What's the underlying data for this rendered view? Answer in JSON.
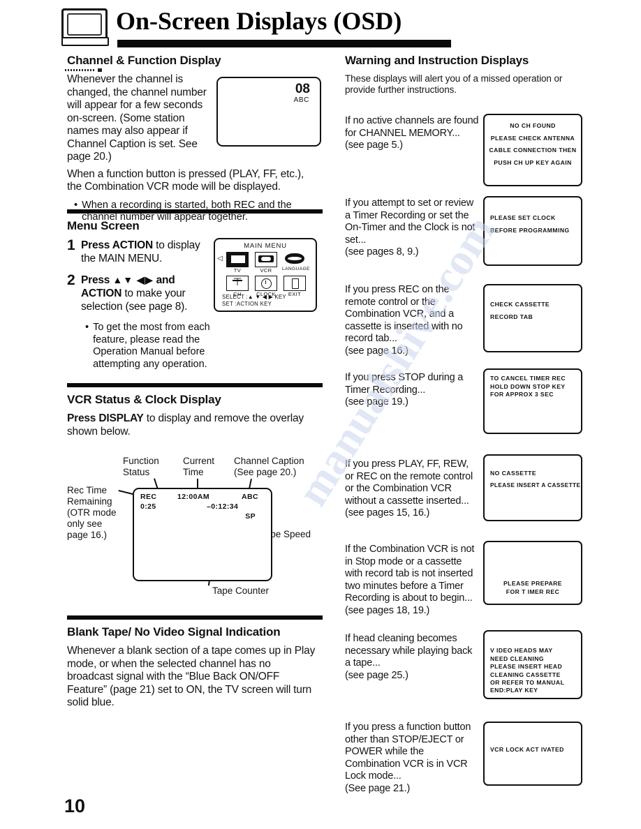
{
  "header": {
    "title": "On-Screen Displays (OSD)",
    "logo_icon": "tv-monitor-icon"
  },
  "page_number": "10",
  "left_column": {
    "section1": {
      "heading": "Channel & Function Display",
      "paragraph1": "Whenever the channel is changed, the channel number will appear for a few seconds on-screen. (Some station names may also appear if Channel Caption is set. See page 20.)",
      "paragraph2": "When a function button is pressed (PLAY, FF, etc.), the Combination VCR mode will be displayed.",
      "bullet": "When a recording is started, both REC and the channel number will appear together.",
      "tv_screen": {
        "channel_number": "08",
        "channel_caption": "ABC"
      }
    },
    "section2": {
      "heading": "Menu Screen",
      "step1_num": "1",
      "step1_a": "Press ACTION",
      "step1_b": " to display the MAIN MENU.",
      "step2_num": "2",
      "step2_a": "Press ",
      "step2_arrows": "▲▼ ◀▶",
      "step2_b": " and ",
      "step2_c": "ACTION",
      "step2_d": " to make your selection (see page 8).",
      "bullet": "To get the most from each feature, please read the Operation Manual before attempting any operation.",
      "main_menu": {
        "title": "MAIN MENU",
        "items": [
          {
            "label": "TV",
            "icon": "tv-icon"
          },
          {
            "label": "VCR",
            "icon": "cassette-icon"
          },
          {
            "label": "LANGUAGE",
            "icon": "mouth-icon"
          },
          {
            "label": "CH",
            "icon": "antenna-icon"
          },
          {
            "label": "CLOCK",
            "icon": "clock-icon"
          },
          {
            "label": "EXIT",
            "icon": "door-icon"
          }
        ],
        "footer_line1": "SELECT :▲ ▼ ◀ ▶  KEY",
        "footer_line2": "SET      :ACTION KEY",
        "cursor": "◁"
      }
    },
    "section3": {
      "heading": "VCR Status & Clock Display",
      "intro_bold": "Press DISPLAY",
      "intro_rest": " to display and remove the overlay shown below.",
      "callouts": {
        "function_status": "Function\nStatus",
        "current_time": "Current\nTime",
        "channel_caption": "Channel Caption\n(See page 20.)",
        "rec_time_remaining": "Rec Time\nRemaining\n(OTR mode\nonly see\npage 16.)",
        "tape_speed": "Tape Speed",
        "tape_counter": "Tape Counter"
      },
      "overlay": {
        "status": "REC",
        "rec_remaining": "0:25",
        "clock": "12:00AM",
        "caption": "ABC",
        "counter": "–0:12:34",
        "speed": "SP"
      }
    },
    "section4": {
      "heading": "Blank Tape/ No Video Signal Indication",
      "paragraph": "Whenever a blank section of a tape comes up in Play mode, or when the selected channel has no broadcast signal with the “Blue Back ON/OFF Feature” (page 21) set to ON, the TV screen will turn solid blue."
    }
  },
  "right_column": {
    "heading": "Warning and Instruction Displays",
    "intro": "These displays will alert you of a missed operation or provide further instructions.",
    "items": [
      {
        "text": "If no active channels are found for CHANNEL MEMORY...\n(see page 5.)",
        "osd_lines": [
          "NO CH FOUND",
          "PLEASE CHECK ANTENNA",
          "CABLE CONNECTION THEN",
          "PUSH CH UP KEY AGAIN"
        ],
        "align": "center"
      },
      {
        "text": "If you attempt to set or review a Timer Recording or set the On-Timer and the Clock is not set...\n(see pages 8, 9.)",
        "osd_lines": [
          "PLEASE SET CLOCK",
          "BEFORE PROGRAMMING"
        ],
        "align": "left"
      },
      {
        "text": "If you press REC on the remote control or the Combination VCR, and a cassette is inserted with no record tab...\n(see page 16.)",
        "osd_lines": [
          "CHECK CASSETTE",
          "RECORD TAB"
        ],
        "align": "left"
      },
      {
        "text": "If you press STOP during a Timer Recording...\n(see page 19.)",
        "osd_lines": [
          "TO CANCEL  TIMER REC",
          "HOLD DOWN STOP KEY",
          "FOR APPROX  3 SEC"
        ],
        "align": "left"
      },
      {
        "text": "If you press PLAY, FF, REW, or REC on the remote control or the Combination VCR without a cassette inserted...\n(see pages 15, 16.)",
        "osd_lines": [
          "NO CASSETTE",
          "PLEASE  INSERT A CASSETTE"
        ],
        "align": "left"
      },
      {
        "text": "If the Combination VCR is not in Stop mode or a cassette with record tab is not inserted two minutes before a Timer Recording is about to begin...\n(see pages 18, 19.)",
        "osd_lines": [
          "PLEASE PREPARE",
          "FOR T IMER REC"
        ],
        "align": "center"
      },
      {
        "text": "If head cleaning becomes necessary while playing back a tape...\n(see page 25.)",
        "osd_lines": [
          "V IDEO HEADS MAY",
          "NEED CLEANING",
          "PLEASE  INSERT HEAD",
          "CLEANING CASSETTE",
          "OR REFER  TO MANUAL",
          "",
          "END:PLAY KEY"
        ],
        "align": "left"
      },
      {
        "text": "If you press a function button other than STOP/EJECT or POWER while the Combination VCR is in VCR Lock mode...\n(See page 21.)",
        "osd_lines": [
          "VCR LOCK ACT IVATED"
        ],
        "align": "left"
      }
    ]
  }
}
